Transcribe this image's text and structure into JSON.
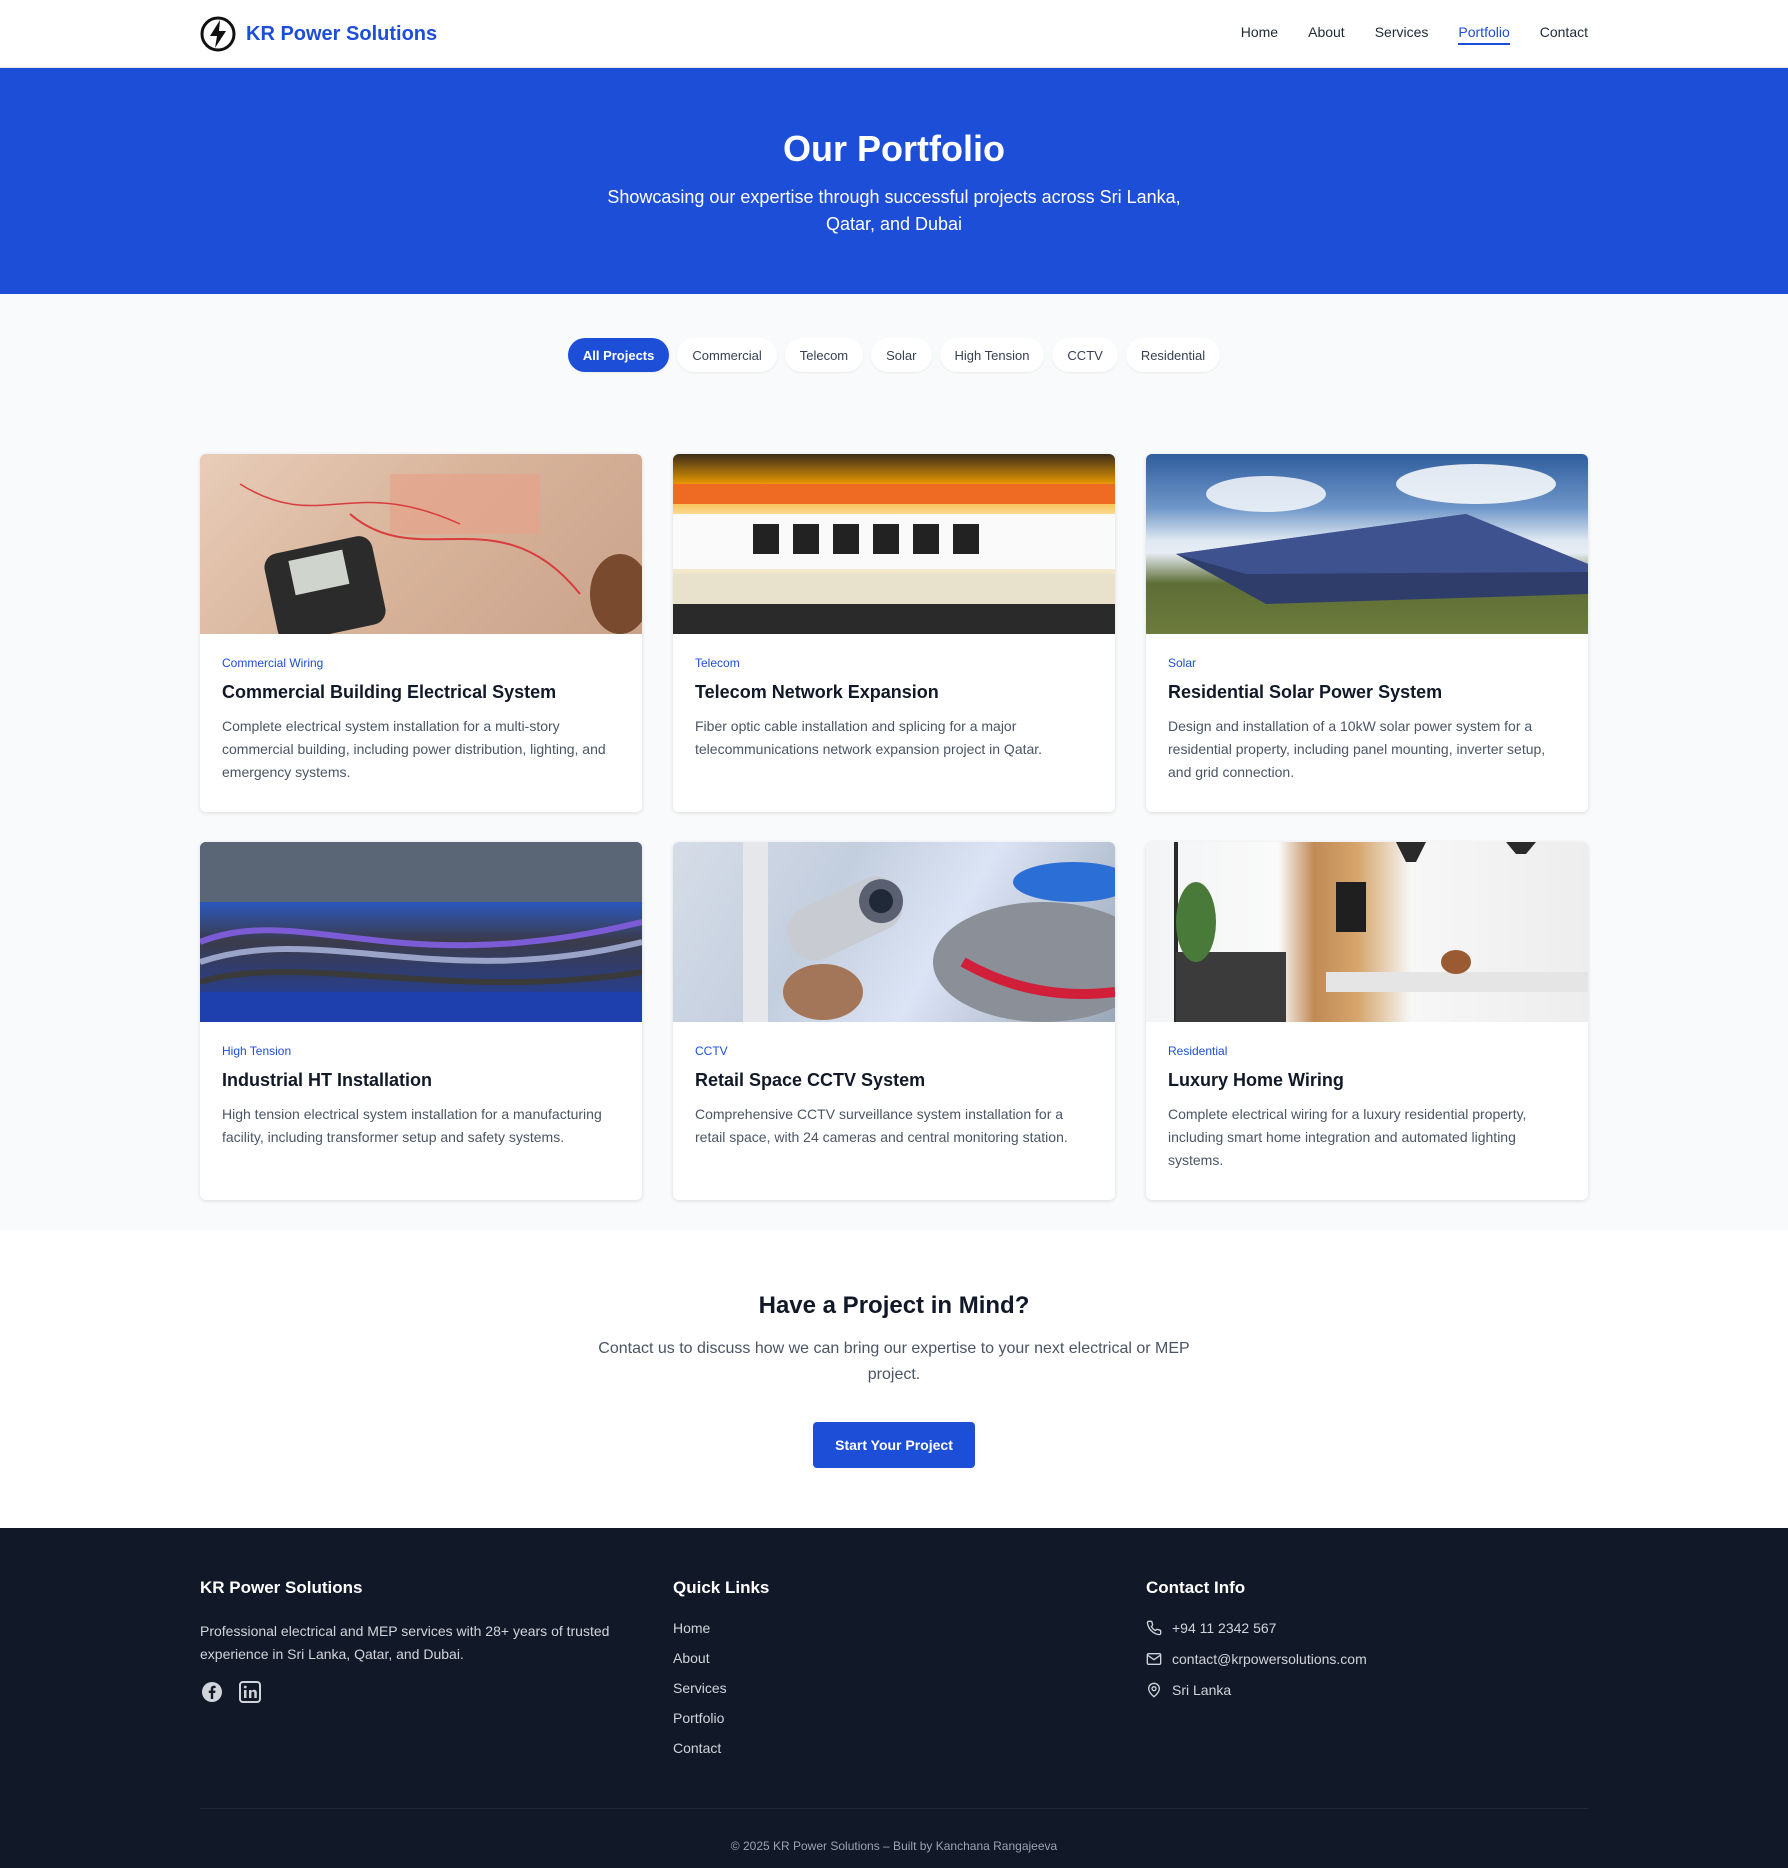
{
  "header": {
    "brand": "KR Power Solutions",
    "nav": [
      {
        "label": "Home",
        "active": false
      },
      {
        "label": "About",
        "active": false
      },
      {
        "label": "Services",
        "active": false
      },
      {
        "label": "Portfolio",
        "active": true
      },
      {
        "label": "Contact",
        "active": false
      }
    ]
  },
  "hero": {
    "title": "Our Portfolio",
    "subtitle": "Showcasing our expertise through successful projects across Sri Lanka, Qatar, and Dubai"
  },
  "filters": [
    "All Projects",
    "Commercial",
    "Telecom",
    "Solar",
    "High Tension",
    "CCTV",
    "Residential"
  ],
  "active_filter": "All Projects",
  "projects": [
    {
      "category": "Commercial Wiring",
      "title": "Commercial Building Electrical System",
      "description": "Complete electrical system installation for a multi-story commercial building, including power distribution, lighting, and emergency systems."
    },
    {
      "category": "Telecom",
      "title": "Telecom Network Expansion",
      "description": "Fiber optic cable installation and splicing for a major telecommunications network expansion project in Qatar."
    },
    {
      "category": "Solar",
      "title": "Residential Solar Power System",
      "description": "Design and installation of a 10kW solar power system for a residential property, including panel mounting, inverter setup, and grid connection."
    },
    {
      "category": "High Tension",
      "title": "Industrial HT Installation",
      "description": "High tension electrical system installation for a manufacturing facility, including transformer setup and safety systems."
    },
    {
      "category": "CCTV",
      "title": "Retail Space CCTV System",
      "description": "Comprehensive CCTV surveillance system installation for a retail space, with 24 cameras and central monitoring station."
    },
    {
      "category": "Residential",
      "title": "Luxury Home Wiring",
      "description": "Complete electrical wiring for a luxury residential property, including smart home integration and automated lighting systems."
    }
  ],
  "cta": {
    "title": "Have a Project in Mind?",
    "text": "Contact us to discuss how we can bring our expertise to your next electrical or MEP project.",
    "button": "Start Your Project"
  },
  "footer": {
    "brand": "KR Power Solutions",
    "about": "Professional electrical and MEP services with 28+ years of trusted experience in Sri Lanka, Qatar, and Dubai.",
    "quick_links_title": "Quick Links",
    "quick_links": [
      "Home",
      "About",
      "Services",
      "Portfolio",
      "Contact"
    ],
    "contact_title": "Contact Info",
    "phone": "+94 11 2342 567",
    "email": "contact@krpowersolutions.com",
    "location": "Sri Lanka",
    "copyright": "© 2025 KR Power Solutions – Built by Kanchana Rangajeeva"
  },
  "colors": {
    "primary": "#1d4ed8",
    "footer_bg": "#111827",
    "section_bg": "#f9fafb"
  },
  "icons": {
    "brand": "lightning-bolt-icon",
    "socials": [
      "facebook-icon",
      "linkedin-icon"
    ],
    "contact": [
      "phone-icon",
      "mail-icon",
      "map-pin-icon"
    ]
  }
}
